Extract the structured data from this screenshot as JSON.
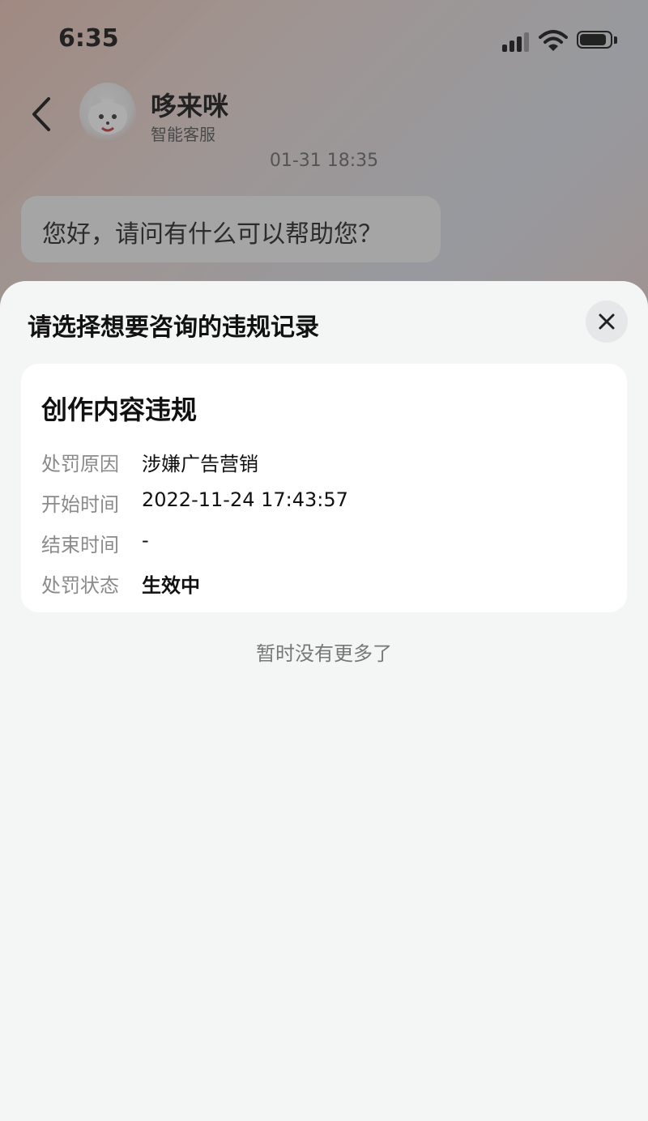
{
  "status_bar": {
    "time": "6:35"
  },
  "chat": {
    "bot_name": "哆来咪",
    "bot_subtitle": "智能客服",
    "timestamp": "01-31 18:35",
    "message": "您好，请问有什么可以帮助您？"
  },
  "sheet": {
    "title": "请选择想要咨询的违规记录",
    "records": [
      {
        "title": "创作内容违规",
        "fields": [
          {
            "label": "处罚原因",
            "value": "涉嫌广告营销"
          },
          {
            "label": "开始时间",
            "value": "2022-11-24 17:43:57"
          },
          {
            "label": "结束时间",
            "value": "-"
          },
          {
            "label": "处罚状态",
            "value": "生效中"
          }
        ]
      }
    ],
    "no_more_text": "暂时没有更多了"
  },
  "icons": {
    "back": "chevron-left-icon",
    "close": "close-icon",
    "signal": "signal-icon",
    "wifi": "wifi-icon",
    "battery": "battery-icon"
  },
  "colors": {
    "sheet_background": "#f4f5f5",
    "card_background": "#ffffff",
    "label_gray": "#8a8a8a",
    "text_dark": "#111111"
  }
}
